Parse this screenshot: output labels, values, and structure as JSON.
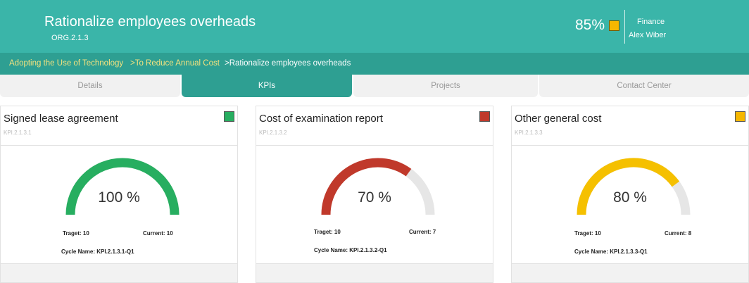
{
  "header": {
    "title": "Rationalize employees overheads",
    "org_code": "ORG.2.1.3",
    "percent": "85%",
    "status_color": "#f5b700",
    "department": "Finance",
    "owner": "Alex Wiber"
  },
  "breadcrumb": {
    "item1": "Adopting the Use of Technology",
    "item2": ">To Reduce Annual Cost",
    "item3": ">Rationalize employees overheads"
  },
  "tabs": {
    "details": "Details",
    "kpis": "KPIs",
    "projects": "Projects",
    "contact": "Contact Center"
  },
  "kpis": [
    {
      "title": "Signed lease agreement",
      "code": "KPI.2.1.3.1",
      "status_color": "#27ae60",
      "percent_text": "100 %",
      "progress": 1.0,
      "gauge_color": "#27ae60",
      "target": "Traget: 10",
      "current": "Current: 10",
      "cycle": "Cycle Name: KPI.2.1.3.1-Q1"
    },
    {
      "title": "Cost of examination report",
      "code": "KPI.2.1.3.2",
      "status_color": "#c0392b",
      "percent_text": "70 %",
      "progress": 0.7,
      "gauge_color": "#c0392b",
      "target": "Traget: 10",
      "current": "Current: 7",
      "cycle": "Cycle Name: KPI.2.1.3.2-Q1"
    },
    {
      "title": "Other general cost",
      "code": "KPI.2.1.3.3",
      "status_color": "#f5b700",
      "percent_text": "80 %",
      "progress": 0.8,
      "gauge_color": "#f5c000",
      "target": "Traget: 10",
      "current": "Current: 8",
      "cycle": "Cycle Name: KPI.2.1.3.3-Q1"
    }
  ]
}
